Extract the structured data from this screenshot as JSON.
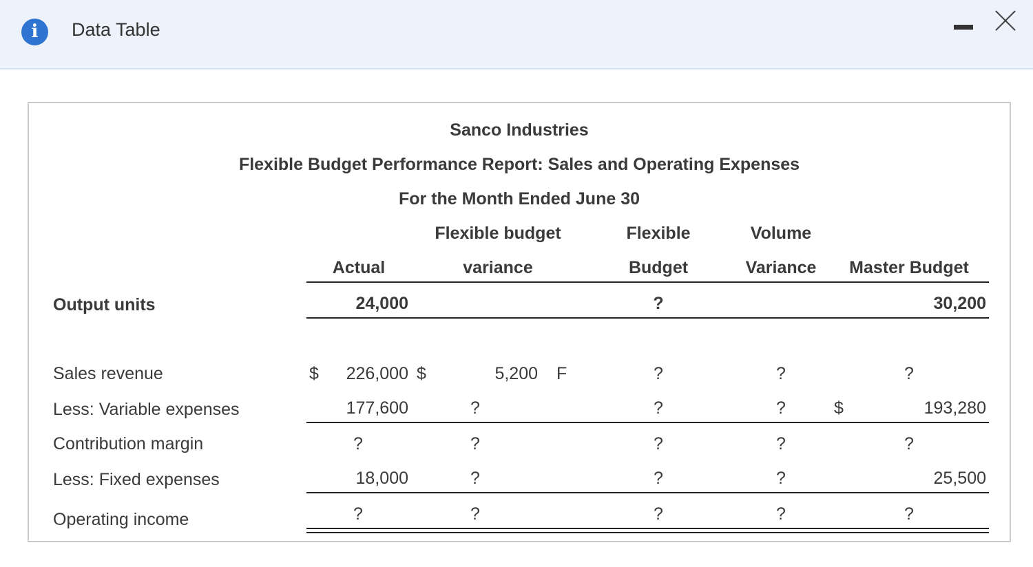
{
  "window": {
    "title": "Data Table",
    "icon": "info-icon",
    "minimize_icon": "minimize-icon",
    "close_icon": "close-icon"
  },
  "report": {
    "company": "Sanco Industries",
    "title": "Flexible Budget Performance Report: Sales and Operating Expenses",
    "period": "For the Month Ended June 30",
    "headers": {
      "actual": "Actual",
      "flex_var_line1": "Flexible budget",
      "flex_var_line2": "variance",
      "flex_budget_line1": "Flexible",
      "flex_budget_line2": "Budget",
      "volume_var_line1": "Volume",
      "volume_var_line2": "Variance",
      "master": "Master Budget"
    },
    "output_units": {
      "label": "Output units",
      "actual": "24,000",
      "flexible_budget": "?",
      "master_budget": "30,200"
    },
    "rows": [
      {
        "label": "Sales revenue",
        "actual_dollar": "$",
        "actual": "226,000",
        "fbv_dollar": "$",
        "fbv": "5,200",
        "fbv_fu": "F",
        "flexible_budget": "?",
        "volume_variance": "?",
        "master_dollar": "",
        "master_budget": "?"
      },
      {
        "label": "Less: Variable expenses",
        "actual_dollar": "",
        "actual": "177,600",
        "fbv_dollar": "",
        "fbv": "?",
        "fbv_fu": "",
        "flexible_budget": "?",
        "volume_variance": "?",
        "master_dollar": "$",
        "master_budget": "193,280"
      },
      {
        "label": "Contribution margin",
        "actual_dollar": "",
        "actual": "?",
        "fbv_dollar": "",
        "fbv": "?",
        "fbv_fu": "",
        "flexible_budget": "?",
        "volume_variance": "?",
        "master_dollar": "",
        "master_budget": "?"
      },
      {
        "label": "Less: Fixed expenses",
        "actual_dollar": "",
        "actual": "18,000",
        "fbv_dollar": "",
        "fbv": "?",
        "fbv_fu": "",
        "flexible_budget": "?",
        "volume_variance": "?",
        "master_dollar": "",
        "master_budget": "25,500"
      },
      {
        "label": "Operating income",
        "actual_dollar": "",
        "actual": "?",
        "fbv_dollar": "",
        "fbv": "?",
        "fbv_fu": "",
        "flexible_budget": "?",
        "volume_variance": "?",
        "master_dollar": "",
        "master_budget": "?"
      }
    ]
  }
}
